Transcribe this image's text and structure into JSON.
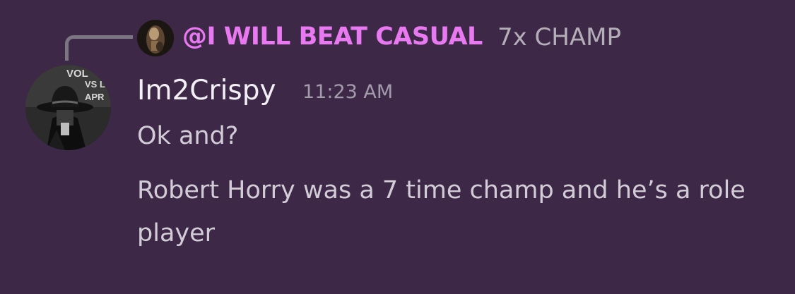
{
  "reply": {
    "author": "@I WILL BEAT CASUAL",
    "text": "7x CHAMP",
    "avatar_icon": "reply-author-avatar"
  },
  "message": {
    "author": "Im2Crispy",
    "timestamp": "11:23 AM",
    "avatar_icon": "cowboy-hat-avatar",
    "avatar_sign_text": [
      "VOL",
      "VS L",
      "APR"
    ],
    "lines": [
      "Ok and?",
      "Robert Horry was a 7 time champ and he’s a role player"
    ]
  },
  "colors": {
    "background": "#3e2848",
    "mention": "#e879f0",
    "username": "#f2f0f4",
    "muted": "#a39cab",
    "message": "#d2ccd6",
    "spine": "#7c7582"
  }
}
